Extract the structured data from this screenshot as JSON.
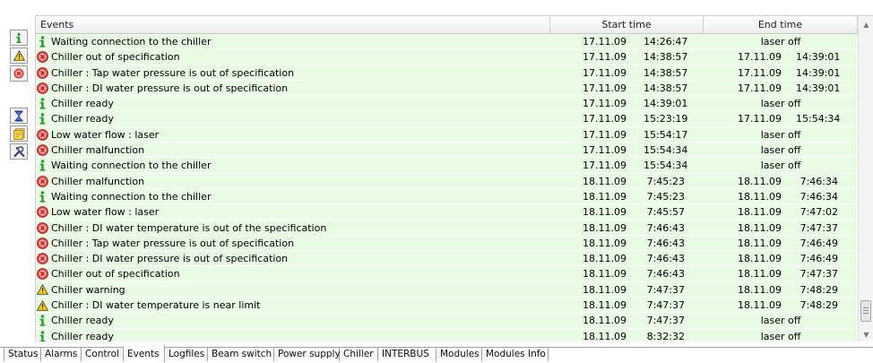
{
  "toolbar": {
    "buttons": [
      {
        "icon": "info-filter-icon"
      },
      {
        "icon": "warning-filter-icon"
      },
      {
        "icon": "error-filter-icon"
      },
      {
        "icon": "hourglass-icon"
      },
      {
        "icon": "notes-icon"
      },
      {
        "icon": "tools-icon"
      }
    ]
  },
  "table": {
    "headers": {
      "events": "Events",
      "start": "Start time",
      "end": "End time"
    },
    "rows": [
      {
        "type": "info",
        "event": "Waiting connection to the chiller",
        "start_date": "17.11.09",
        "start_time": "14:26:47",
        "end": "laser off"
      },
      {
        "type": "error",
        "event": "Chiller out of specification",
        "start_date": "17.11.09",
        "start_time": "14:38:57",
        "end_date": "17.11.09",
        "end_time": "14:39:01"
      },
      {
        "type": "error",
        "event": "Chiller  : Tap water pressure is out of specification",
        "start_date": "17.11.09",
        "start_time": "14:38:57",
        "end_date": "17.11.09",
        "end_time": "14:39:01"
      },
      {
        "type": "error",
        "event": "Chiller  : DI water pressure is out of specification",
        "start_date": "17.11.09",
        "start_time": "14:38:57",
        "end_date": "17.11.09",
        "end_time": "14:39:01"
      },
      {
        "type": "info",
        "event": "Chiller ready",
        "start_date": "17.11.09",
        "start_time": "14:39:01",
        "end": "laser off"
      },
      {
        "type": "info",
        "event": "Chiller ready",
        "start_date": "17.11.09",
        "start_time": "15:23:19",
        "end_date": "17.11.09",
        "end_time": "15:54:34"
      },
      {
        "type": "error",
        "event": "Low water flow : laser",
        "start_date": "17.11.09",
        "start_time": "15:54:17",
        "end": "laser off"
      },
      {
        "type": "error",
        "event": "Chiller malfunction",
        "start_date": "17.11.09",
        "start_time": "15:54:34",
        "end": "laser off"
      },
      {
        "type": "info",
        "event": "Waiting connection to the chiller",
        "start_date": "17.11.09",
        "start_time": "15:54:34",
        "end": "laser off"
      },
      {
        "type": "error",
        "event": "Chiller malfunction",
        "start_date": "18.11.09",
        "start_time": "7:45:23",
        "end_date": "18.11.09",
        "end_time": "7:46:34"
      },
      {
        "type": "info",
        "event": "Waiting connection to the chiller",
        "start_date": "18.11.09",
        "start_time": "7:45:23",
        "end_date": "18.11.09",
        "end_time": "7:46:34"
      },
      {
        "type": "error",
        "event": "Low water flow : laser",
        "start_date": "18.11.09",
        "start_time": "7:45:57",
        "end_date": "18.11.09",
        "end_time": "7:47:02"
      },
      {
        "type": "error",
        "event": "Chiller  : DI water temperature is out of the specification",
        "start_date": "18.11.09",
        "start_time": "7:46:43",
        "end_date": "18.11.09",
        "end_time": "7:47:37"
      },
      {
        "type": "error",
        "event": "Chiller  : Tap water pressure is out of specification",
        "start_date": "18.11.09",
        "start_time": "7:46:43",
        "end_date": "18.11.09",
        "end_time": "7:46:49"
      },
      {
        "type": "error",
        "event": "Chiller  : DI water pressure is out of specification",
        "start_date": "18.11.09",
        "start_time": "7:46:43",
        "end_date": "18.11.09",
        "end_time": "7:46:49"
      },
      {
        "type": "error",
        "event": "Chiller out of specification",
        "start_date": "18.11.09",
        "start_time": "7:46:43",
        "end_date": "18.11.09",
        "end_time": "7:47:37"
      },
      {
        "type": "warning",
        "event": "Chiller warning",
        "start_date": "18.11.09",
        "start_time": "7:47:37",
        "end_date": "18.11.09",
        "end_time": "7:48:29"
      },
      {
        "type": "warning",
        "event": "Chiller  : DI water temperature is near limit",
        "start_date": "18.11.09",
        "start_time": "7:47:37",
        "end_date": "18.11.09",
        "end_time": "7:48:29"
      },
      {
        "type": "info",
        "event": "Chiller ready",
        "start_date": "18.11.09",
        "start_time": "7:47:37",
        "end": "laser off"
      },
      {
        "type": "info",
        "event": "Chiller ready",
        "start_date": "18.11.09",
        "start_time": "8:32:32",
        "end": "laser off"
      }
    ]
  },
  "tabs": [
    {
      "label": "Status"
    },
    {
      "label": "Alarms"
    },
    {
      "label": "Control"
    },
    {
      "label": "Events",
      "active": true
    },
    {
      "label": "Logfiles"
    },
    {
      "label": "Beam switch"
    },
    {
      "label": "Power supply"
    },
    {
      "label": "Chiller"
    },
    {
      "label": "INTERBUS"
    },
    {
      "label": "Modules"
    },
    {
      "label": "Modules Info"
    }
  ],
  "colors": {
    "row_bg": "#e9fbe5",
    "info": "#2f9a2f",
    "error": "#d43b3b",
    "warning": "#e8c200"
  }
}
